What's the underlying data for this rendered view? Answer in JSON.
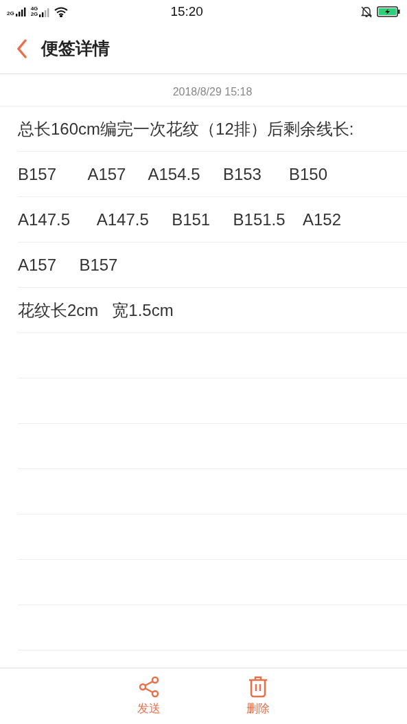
{
  "status_bar": {
    "sim1_label": "2G",
    "sim2_labels": [
      "4G",
      "2G"
    ],
    "time": "15:20"
  },
  "header": {
    "title": "便签详情"
  },
  "note": {
    "timestamp": "2018/8/29 15:18",
    "lines": [
      "总长160cm编完一次花纹（12排）后剩余线长:",
      "B157       A157     A154.5     B153      B150",
      "A147.5      A147.5     B151     B151.5    A152",
      "A157     B157",
      "花纹长2cm   宽1.5cm"
    ]
  },
  "bottom_bar": {
    "actions": [
      {
        "kind": "share",
        "label": "发送"
      },
      {
        "kind": "delete",
        "label": "删除"
      }
    ]
  }
}
